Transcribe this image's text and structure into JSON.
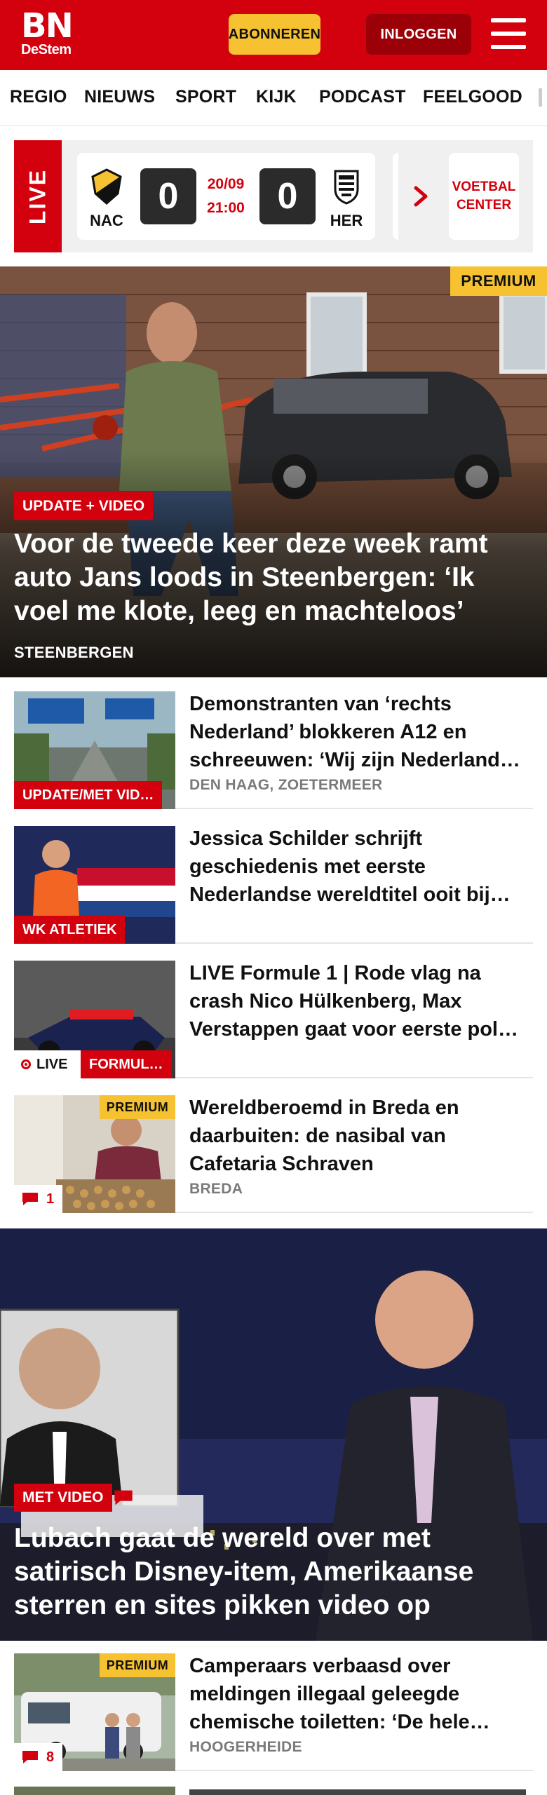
{
  "header": {
    "logo_main": "BN",
    "logo_sub": "DeStem",
    "subscribe_label": "ABONNEREN",
    "login_label": "INLOGGEN",
    "menu_icon": "hamburger-menu-icon"
  },
  "nav": {
    "items": [
      "REGIO",
      "NIEUWS",
      "SPORT",
      "KIJK",
      "PODCAST",
      "FEELGOOD"
    ]
  },
  "live_strip": {
    "label": "LIVE",
    "home_team": "NAC",
    "home_score": "0",
    "away_team": "HER",
    "away_score": "0",
    "date": "20/09",
    "time": "21:00",
    "football_center_label": "VOETBAL CENTER"
  },
  "hero": {
    "premium": "PREMIUM",
    "label": "UPDATE + VIDEO",
    "title": "Voor de tweede keer deze week ramt auto Jans loods in Steenbergen: ‘Ik voel me klote, leeg en machteloos’",
    "location": "STEENBERGEN"
  },
  "articles": [
    {
      "label": "UPDATE/MET VID…",
      "title": "Demonstranten van ‘rechts Nederland’ blokkeren A12 en schreeuwen: ‘Wij zijn Nederland…",
      "location": "DEN HAAG, ZOETERMEER"
    },
    {
      "label": "WK ATLETIEK",
      "title": "Jessica Schilder schrijft geschiedenis met eerste Nederlandse wereldtitel ooit bij…"
    },
    {
      "live_label": "LIVE",
      "label": "FORMUL…",
      "title": "LIVE Formule 1 | Rode vlag na crash Nico Hülkenberg, Max Verstappen gaat voor eerste pol…"
    },
    {
      "premium": "PREMIUM",
      "comments": "1",
      "title": "Wereldberoemd in Breda en daarbuiten: de nasibal van Cafetaria Schraven",
      "location": "BREDA"
    }
  ],
  "video_article": {
    "label": "MET VIDEO",
    "title": "Lubach gaat de wereld over met satirisch Disney-item, Amerikaanse sterren en sites pikken video op"
  },
  "article_after_video": {
    "premium": "PREMIUM",
    "comments": "8",
    "title": "Camperaars verbaasd over meldingen illegaal geleegde chemische toiletten: ‘De hele…",
    "location": "HOOGERHEIDE"
  },
  "colors": {
    "brand_red": "#d3000d",
    "premium_yellow": "#f6c232",
    "login_dark_red": "#9b0008"
  }
}
